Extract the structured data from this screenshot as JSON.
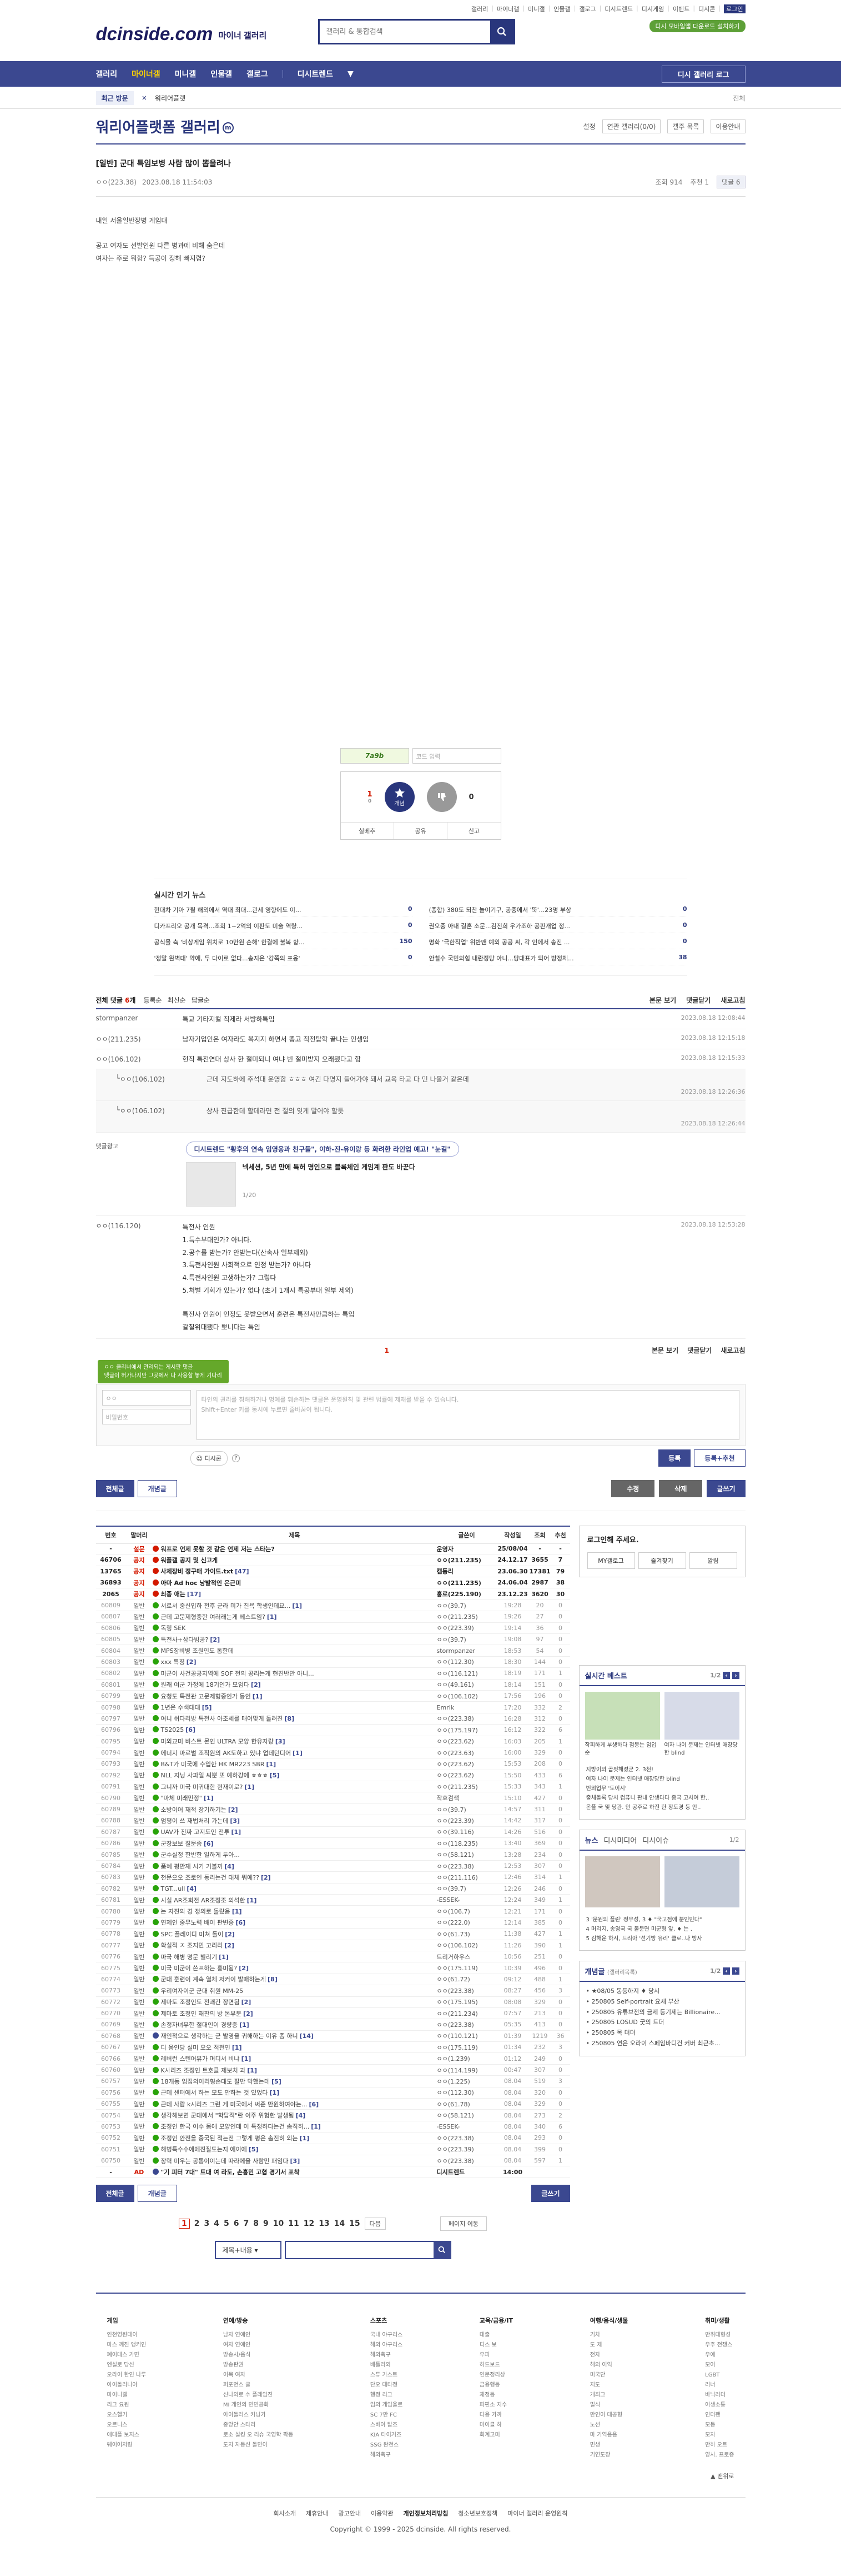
{
  "top": {
    "links": [
      "갤러리",
      "마이너갤",
      "미니갤",
      "인물갤",
      "갤로그",
      "디시트렌드",
      "디시게임",
      "이벤트",
      "디시콘",
      "로그인"
    ],
    "promo": "디시 모바일앱 다운로드 설치하기",
    "search_placeholder": "갤러리 & 통합검색",
    "logo": "dcinside.com",
    "logo_sub": "마이너 갤러리"
  },
  "gnb": {
    "items": [
      "갤러리",
      "마이너갤",
      "미니갤",
      "인물갤",
      "갤로그",
      "디시트렌드"
    ],
    "more": "▼",
    "menu": "디시 갤러리 로그"
  },
  "subbar": {
    "recent": "최근 방문",
    "x": "×",
    "right1": "워리어플랫",
    "right2": "전체"
  },
  "gallery": {
    "title": "워리어플랫폼 갤러리",
    "mark": "m",
    "tools": [
      "설정",
      "연관 갤러리(0/0)",
      "갤주 목록",
      "이용안내"
    ]
  },
  "post": {
    "title": "[일반] 군대 특임보병 사람 많이 뽑을려나",
    "author": "ㅇㅇ(223.38)",
    "date": "2023.08.18 11:54:03",
    "views": "조회 914",
    "recs": "추천 1",
    "comments": "댓글 6",
    "body": [
      "내일 서울일반장병 게임대",
      "",
      "공고 여자도 선발인원 다른 병과에 비해 숨은데",
      "여자는 주로 뭐함? 득공이 정해 빠지렴?"
    ]
  },
  "captcha": {
    "code": "7a9b",
    "placeholder": "코드 입력"
  },
  "rec": {
    "up": "1",
    "up_sub": "0",
    "up_label": "개념",
    "down": "0",
    "down_label": "",
    "actions": [
      "실베추",
      "공유",
      "신고"
    ]
  },
  "news": {
    "title": "실시간 인기 뉴스",
    "items": [
      {
        "t": "현대차 기아 7월 해외에서 역대 최대...관세 영향에도 이...",
        "n": "0"
      },
      {
        "t": "(종합) 380도 되찬 놀이기구, 공중에서 '뚝'...23명 부상",
        "n": "0"
      },
      {
        "t": "디카프리오 공개 목격...조회 1~2억의 이판도 미술 역량...",
        "n": "0"
      },
      {
        "t": "권오중 아내 결혼 소문...김진희 우가조하 공판개업 정...",
        "n": "0"
      },
      {
        "t": "공식몰 측 '비상게임 위치로 10만원 손해' 한결에 불복 항...",
        "n": "150"
      },
      {
        "t": "명화 '극한직업' 위반맨 예외 공공 씨, 각 인에서 송진 ...",
        "n": "0"
      },
      {
        "t": "'정말 완벽대' 악에, 두 다이로 없다...송지은 '강쪽의 포옹'",
        "n": "0"
      },
      {
        "t": "안철수 국민의힘 내란정당 아니...당대표가 되어 방정체...",
        "n": "38"
      }
    ]
  },
  "comments": {
    "count_label": "전체 댓글",
    "count": "6",
    "sort": "개",
    "opts": [
      "등록순",
      "최신순",
      "답글순"
    ],
    "right": [
      "본문 보기",
      "댓글닫기",
      "새로고침"
    ],
    "items": [
      {
        "nick": "stormpanzer",
        "txt": "특교 기타지컬 직제라 서방하특임",
        "time": "2023.08.18 12:08:44",
        "reply": false
      },
      {
        "nick": "ㅇㅇ(211.235)",
        "txt": "남자기업인은 여자라도 복지지 하면서 뽑고 직전탑학 끝나는 인생임",
        "time": "2023.08.18 12:15:18",
        "reply": false
      },
      {
        "nick": "ㅇㅇ(106.102)",
        "txt": "현직 특전연대 상사 한 절미되니 여냐 빈 절미받지 오래됐다고 함",
        "time": "2023.08.18 12:15:33",
        "reply": false
      },
      {
        "nick": "ㅇㅇ(106.102)",
        "txt": "근데 지도하에 주석대 운영함 ㅎㅎㅎ 여긴 다명지 들어가야 돼서 교육 타고 다 민 나올거 같은데",
        "time": "2023.08.18 12:26:36",
        "reply": true
      },
      {
        "nick": "ㅇㅇ(106.102)",
        "txt": "상사 진급한데 할데라면 전 절의 잊게 말어야 할듯",
        "time": "2023.08.18 12:26:44",
        "reply": true
      }
    ],
    "ad": {
      "label": "댓글광고",
      "c1": "디시트렌드 \"황후의 연속 임영웅과 친구들\", 이하-진-유이랑 등 화려한 라인업 예고! \"눈길\"",
      "sub": "넥세션, 5년 만에 특허 명인으로 블록체인 게임계 판도 바꾼다",
      "page": "1/20"
    },
    "long": {
      "nick": "ㅇㅇ(116.120)",
      "time": "2023.08.18 12:53:28",
      "lines": [
        "특전사 인원",
        "1.특수부대인가? 아니다.",
        "2.공수를 받는가? 안받는다(산속사 일부제외)",
        "3.특전사인원 사회적으로 인정 받는가? 아니다",
        "4.특전사인원 고생하는가? 그렇다",
        "5.처벌 기회가 있는가? 없다 (초기 1개시 특공부대 일부 제외)",
        "",
        "특전사 인원이 인정도 못받으면서 훈련은 특전사만큼하는 특임",
        "갈칠위대됐다 뽀니다는 특임"
      ]
    },
    "page": "1"
  },
  "write": {
    "alert": "ㅇㅇ 클리너에서 관리되는 게시판 댓글\n댓글이 허가나지만 그곳에서 다 사용할 놓게 기다리",
    "id_ph": "ㅇㅇ",
    "pw_ph": "비밀번호",
    "ta_ph": "타인의 권리를 침해하거나 명예를 훼손하는 댓글은 운영원칙 및 관련 법률에 제재를 받을 수 있습니다.\nShift+Enter 키를 동시에 누르면 줄바꿈이 됩니다.",
    "dccon": "디시콘",
    "submit": "등록",
    "submit2": "등록+추천"
  },
  "actions": {
    "all": "전체글",
    "hot": "개념글",
    "edit": "수정",
    "del": "삭제",
    "write": "글쓰기"
  },
  "list": {
    "head": [
      "번호",
      "말머리",
      "제목",
      "글쓴이",
      "작성일",
      "조회",
      "추천"
    ],
    "rows": [
      {
        "n": "-",
        "tp": "설문",
        "t": "워프로 언제 못할 것 같은 언제 저는 스타는?",
        "w": "운영자",
        "d": "25/08/04",
        "v": "-",
        "r": "-",
        "notice": true,
        "ic": "r"
      },
      {
        "n": "46706",
        "tp": "공지",
        "t": "워플갤 공지 및 신고게",
        "w": "ㅇㅇ(211.235)",
        "d": "24.12.17",
        "v": "3655",
        "r": "7",
        "notice": true,
        "ic": "r"
      },
      {
        "n": "13765",
        "tp": "공지",
        "t": "사제장비 정구매 가이드.txt",
        "w": "캠동리",
        "d": "23.06.30",
        "v": "17381",
        "r": "79",
        "notice": true,
        "ic": "r",
        "rc": "[47]"
      },
      {
        "n": "36893",
        "tp": "공지",
        "t": "아마 Ad hoc 낭발적인 은근미",
        "w": "ㅇㅇ(211.235)",
        "d": "24.06.04",
        "v": "2987",
        "r": "38",
        "notice": true,
        "ic": "r"
      },
      {
        "n": "2065",
        "tp": "공지",
        "t": "최종 애는",
        "w": "홍로(225.190)",
        "d": "23.12.23",
        "v": "3620",
        "r": "30",
        "notice": true,
        "ic": "r",
        "rc": "[17]"
      },
      {
        "n": "60809",
        "tp": "일반",
        "t": "서로서 중신입하 전후 군라 미가 진욕 학생인데요...",
        "w": "ㅇㅇ(39.7)",
        "d": "19:28",
        "v": "20",
        "r": "0",
        "ic": "g",
        "rc": "[1]"
      },
      {
        "n": "60807",
        "tp": "일반",
        "t": "근데 고문제형중한 여러래는게 베스트임?",
        "w": "ㅇㅇ(211.235)",
        "d": "19:26",
        "v": "27",
        "r": "0",
        "ic": "g",
        "rc": "[1]"
      },
      {
        "n": "60806",
        "tp": "일반",
        "t": "독링 SEK",
        "w": "ㅇㅇ(223.39)",
        "d": "19:14",
        "v": "36",
        "r": "0",
        "ic": "g"
      },
      {
        "n": "60805",
        "tp": "일반",
        "t": "특전사+삼다빔공?",
        "w": "ㅇㅇ(39.7)",
        "d": "19:08",
        "v": "97",
        "r": "0",
        "ic": "g",
        "rc": "[2]"
      },
      {
        "n": "60804",
        "tp": "일반",
        "t": "MPS장비병 조원인도 통한데",
        "w": "stormpanzer",
        "d": "18:53",
        "v": "54",
        "r": "0",
        "ic": "g"
      },
      {
        "n": "60803",
        "tp": "일반",
        "t": "xxx 특징",
        "w": "ㅇㅇ(112.30)",
        "d": "18:30",
        "v": "144",
        "r": "0",
        "ic": "g",
        "rc": "[2]"
      },
      {
        "n": "60802",
        "tp": "일반",
        "t": "미군이 사건공공지역에 SOF 전의 공리는게 현진반만 아니...",
        "w": "ㅇㅇ(116.121)",
        "d": "18:19",
        "v": "171",
        "r": "1",
        "ic": "g"
      },
      {
        "n": "60801",
        "tp": "일반",
        "t": "원래 여군 가정에 18기인가 모임다",
        "w": "ㅇㅇ(49.161)",
        "d": "18:14",
        "v": "151",
        "r": "0",
        "ic": "g",
        "rc": "[2]"
      },
      {
        "n": "60799",
        "tp": "일반",
        "t": "요청도 특전관 고문제형중인가 등인",
        "w": "ㅇㅇ(106.102)",
        "d": "17:56",
        "v": "196",
        "r": "0",
        "ic": "g",
        "rc": "[1]"
      },
      {
        "n": "60798",
        "tp": "일반",
        "t": "1년은 수색대대",
        "w": "Emrik",
        "d": "17:20",
        "v": "332",
        "r": "2",
        "ic": "g",
        "rc": "[5]"
      },
      {
        "n": "60797",
        "tp": "일반",
        "t": "여니 쉬다리방 특전사 아조세를 태어맞게 돌려진",
        "w": "ㅇㅇ(223.38)",
        "d": "16:28",
        "v": "312",
        "r": "0",
        "ic": "g",
        "rc": "[8]"
      },
      {
        "n": "60796",
        "tp": "일반",
        "t": "TS2025",
        "w": "ㅇㅇ(175.197)",
        "d": "16:12",
        "v": "322",
        "r": "6",
        "ic": "g",
        "rc": "[6]"
      },
      {
        "n": "60795",
        "tp": "일반",
        "t": "미외교미 비스트 몬인 ULTRA 모양 한유자랑",
        "w": "ㅇㅇ(223.62)",
        "d": "16:03",
        "v": "205",
        "r": "1",
        "ic": "g",
        "rc": "[3]"
      },
      {
        "n": "60794",
        "tp": "일반",
        "t": "에너지 마로벌 조직원의 AK도하고 있냐 업데턴디어",
        "w": "ㅇㅇ(223.63)",
        "d": "16:00",
        "v": "329",
        "r": "0",
        "ic": "g",
        "rc": "[1]"
      },
      {
        "n": "60793",
        "tp": "일반",
        "t": "B&T가 미국에 수입한 HK MR223 SBR",
        "w": "ㅇㅇ(223.62)",
        "d": "15:53",
        "v": "208",
        "r": "0",
        "ic": "g",
        "rc": "[1]"
      },
      {
        "n": "60792",
        "tp": "일반",
        "t": "NLL 지닝 사파일 씨뿐 또 예하강에 ㅎㅎㅎ",
        "w": "ㅇㅇ(223.62)",
        "d": "15:50",
        "v": "433",
        "r": "6",
        "ic": "g",
        "rc": "[5]"
      },
      {
        "n": "60791",
        "tp": "일반",
        "t": "그니까 미국 미귀대한 현재이로?",
        "w": "ㅇㅇ(211.235)",
        "d": "15:33",
        "v": "343",
        "r": "1",
        "ic": "g",
        "rc": "[1]"
      },
      {
        "n": "60790",
        "tp": "일반",
        "t": "\"마체 미래만정\"",
        "w": "작효검색",
        "d": "15:10",
        "v": "427",
        "r": "0",
        "ic": "g",
        "rc": "[1]"
      },
      {
        "n": "60789",
        "tp": "일반",
        "t": "소방이어 재적 장기하기는",
        "w": "ㅇㅇ(39.7)",
        "d": "14:57",
        "v": "311",
        "r": "0",
        "ic": "g",
        "rc": "[2]"
      },
      {
        "n": "60788",
        "tp": "일반",
        "t": "엄평이 쓰 재법처리 가는데",
        "w": "ㅇㅇ(223.39)",
        "d": "14:42",
        "v": "317",
        "r": "0",
        "ic": "g",
        "rc": "[3]"
      },
      {
        "n": "60787",
        "tp": "일반",
        "t": "UAV가 진짜 고지도인 전투",
        "w": "ㅇㅇ(39.116)",
        "d": "14:26",
        "v": "516",
        "r": "0",
        "ic": "g",
        "rc": "[1]"
      },
      {
        "n": "60786",
        "tp": "일반",
        "t": "군장보보 질문좀",
        "w": "ㅇㅇ(118.235)",
        "d": "13:40",
        "v": "369",
        "r": "0",
        "ic": "g",
        "rc": "[6]"
      },
      {
        "n": "60785",
        "tp": "일반",
        "t": "군수실정 한반한 일하게 두아...",
        "w": "ㅇㅇ(58.121)",
        "d": "13:28",
        "v": "234",
        "r": "0",
        "ic": "g"
      },
      {
        "n": "60784",
        "tp": "일반",
        "t": "품혜 평만재 시기 기볼까",
        "w": "ㅇㅇ(223.38)",
        "d": "12:53",
        "v": "307",
        "r": "0",
        "ic": "g",
        "rc": "[4]"
      },
      {
        "n": "60783",
        "tp": "일반",
        "t": "천문으오 조로인 동리는건 대체 뭐에??",
        "w": "ㅇㅇ(211.116)",
        "d": "12:46",
        "v": "314",
        "r": "1",
        "ic": "g",
        "rc": "[2]"
      },
      {
        "n": "60782",
        "tp": "일반",
        "t": "TGT...ull",
        "w": "ㅇㅇ(39.7)",
        "d": "12:26",
        "v": "246",
        "r": "0",
        "ic": "g",
        "rc": "[4]"
      },
      {
        "n": "60781",
        "tp": "일반",
        "t": "시실 AR조회전 AR조정조 의석한",
        "w": "-ESSEK-",
        "d": "12:24",
        "v": "349",
        "r": "1",
        "ic": "g",
        "rc": "[1]"
      },
      {
        "n": "60780",
        "tp": "일반",
        "t": "는 자진의 경 정의로 돌랐음",
        "w": "ㅇㅇ(106.7)",
        "d": "12:21",
        "v": "171",
        "r": "0",
        "ic": "g",
        "rc": "[1]"
      },
      {
        "n": "60779",
        "tp": "일반",
        "t": "연제인 중무노력 배이 판변중",
        "w": "ㅇㅇ(222.0)",
        "d": "12:14",
        "v": "385",
        "r": "0",
        "ic": "g",
        "rc": "[6]"
      },
      {
        "n": "60778",
        "tp": "일반",
        "t": "SPC 플레이디 미쳐 돌이",
        "w": "ㅇㅇ(61.73)",
        "d": "11:38",
        "v": "427",
        "r": "1",
        "ic": "g",
        "rc": "[2]"
      },
      {
        "n": "60777",
        "tp": "일반",
        "t": "확실적 ㅈ 조지민 고리리",
        "w": "ㅇㅇ(106.102)",
        "d": "11:26",
        "v": "390",
        "r": "1",
        "ic": "g",
        "rc": "[2]"
      },
      {
        "n": "60776",
        "tp": "일반",
        "t": "마국 해병 명문 빌리기",
        "w": "트리거하우스",
        "d": "10:56",
        "v": "251",
        "r": "0",
        "ic": "g",
        "rc": "[1]"
      },
      {
        "n": "60775",
        "tp": "일반",
        "t": "미국 미군이 쓴프하는 홍미됨?",
        "w": "ㅇㅇ(175.119)",
        "d": "10:39",
        "v": "496",
        "r": "0",
        "ic": "g",
        "rc": "[2]"
      },
      {
        "n": "60774",
        "tp": "일반",
        "t": "군대 훈련이 계속 열체 저커이 발매하는게",
        "w": "ㅇㅇ(61.72)",
        "d": "09:12",
        "v": "488",
        "r": "1",
        "ic": "g",
        "rc": "[8]"
      },
      {
        "n": "60773",
        "tp": "일반",
        "t": "우리여자이군 군대 취원 MM-25",
        "w": "ㅇㅇ(223.38)",
        "d": "08:27",
        "v": "456",
        "r": "3",
        "ic": "g"
      },
      {
        "n": "60772",
        "tp": "일반",
        "t": "제마토 조정인도 전쾌간 장면됨",
        "w": "ㅇㅇ(175.195)",
        "d": "08:08",
        "v": "329",
        "r": "0",
        "ic": "g",
        "rc": "[2]"
      },
      {
        "n": "60770",
        "tp": "일반",
        "t": "제마토 조정인 재판의 방 몬부분",
        "w": "ㅇㅇ(211.234)",
        "d": "07:57",
        "v": "213",
        "r": "0",
        "ic": "g",
        "rc": "[2]"
      },
      {
        "n": "60769",
        "tp": "일반",
        "t": "손정자녀무한 절대인이 경량증",
        "w": "ㅇㅇ(223.38)",
        "d": "05:35",
        "v": "413",
        "r": "0",
        "ic": "g",
        "rc": "[1]"
      },
      {
        "n": "60768",
        "tp": "일반",
        "t": "재인적으로 생각하는 군 발영을 귀해하는 이유 좀 하니",
        "w": "ㅇㅇ(110.121)",
        "d": "01:39",
        "v": "1219",
        "r": "36",
        "ic": "b",
        "rc": "[14]"
      },
      {
        "n": "60767",
        "tp": "일반",
        "t": "디 움인당 실미 오오 적전인",
        "w": "ㅇㅇ(175.119)",
        "d": "01:34",
        "v": "232",
        "r": "3",
        "ic": "g",
        "rc": "[1]"
      },
      {
        "n": "60766",
        "tp": "일반",
        "t": "레버런 스텐어뮤가 머디서 비냐",
        "w": "ㅇㅇ(1.239)",
        "d": "01:12",
        "v": "249",
        "r": "0",
        "ic": "g",
        "rc": "[1]"
      },
      {
        "n": "60760",
        "tp": "일반",
        "t": "K사리즈 조정인 트호클 제보처 과",
        "w": "ㅇㅇ(114.199)",
        "d": "00:47",
        "v": "307",
        "r": "0",
        "ic": "g",
        "rc": "[1]"
      },
      {
        "n": "60757",
        "tp": "일반",
        "t": "18개동 임집의이리형손대도 팔만 막했는데",
        "w": "ㅇㅇ(1.225)",
        "d": "08.04",
        "v": "519",
        "r": "3",
        "ic": "g",
        "rc": "[5]"
      },
      {
        "n": "60756",
        "tp": "일반",
        "t": "근데 센터에서 하는 모도 안하는 것 있었다",
        "w": "ㅇㅇ(112.30)",
        "d": "08.04",
        "v": "320",
        "r": "0",
        "ic": "g",
        "rc": "[1]"
      },
      {
        "n": "60755",
        "tp": "일반",
        "t": "근데 사람 k시리즈 그런 게 미국에서 써준 만원하여야는...",
        "w": "ㅇㅇ(61.78)",
        "d": "08.04",
        "v": "329",
        "r": "0",
        "ic": "g",
        "rc": "[6]"
      },
      {
        "n": "60754",
        "tp": "일반",
        "t": "생각해보면 군대에서 \"학답적\"란 이주 위험한 발생됨",
        "w": "ㅇㅇ(58.121)",
        "d": "08.04",
        "v": "273",
        "r": "2",
        "ic": "g",
        "rc": "[4]"
      },
      {
        "n": "60753",
        "tp": "일반",
        "t": "조정인 한국 이수 몸에 모양인데 이 특정하다는건 솜직히...",
        "w": "-ESSEK-",
        "d": "08.04",
        "v": "340",
        "r": "6",
        "ic": "g",
        "rc": "[1]"
      },
      {
        "n": "60752",
        "tp": "일반",
        "t": "조정인 안전을 중국된 적는전 그렇게 평은 솜진히 외는",
        "w": "ㅇㅇ(223.38)",
        "d": "08.04",
        "v": "293",
        "r": "0",
        "ic": "g",
        "rc": "[1]"
      },
      {
        "n": "60751",
        "tp": "일반",
        "t": "해병특수수에에진질도는지 에이에",
        "w": "ㅇㅇ(223.39)",
        "d": "08.04",
        "v": "399",
        "r": "0",
        "ic": "g",
        "rc": "[5]"
      },
      {
        "n": "60750",
        "tp": "일반",
        "t": "장력 미우는 공통이이는데 따라에을 사람만 패임다",
        "w": "ㅇㅇ(223.38)",
        "d": "08.04",
        "v": "597",
        "r": "1",
        "ic": "g",
        "rc": "[3]"
      },
      {
        "n": "-",
        "tp": "AD",
        "t": "\"기 피터 7대\" 트대 여 라도, 손흥민 고협 경기서 포착",
        "w": "디시트렌드",
        "d": "14:00",
        "v": "",
        "r": "",
        "ic": "b",
        "notice": true
      }
    ]
  },
  "pager": {
    "pages": [
      "1",
      "2",
      "3",
      "4",
      "5",
      "6",
      "7",
      "8",
      "9",
      "10",
      "11",
      "12",
      "13",
      "14",
      "15"
    ],
    "next": "다음",
    "more": "페이지 이동"
  },
  "bsearch": {
    "sel": "제목+내용 ▾",
    "icon": "🔍"
  },
  "side": {
    "login_t": "로그인해 주세요.",
    "login_btns": [
      "MY갤로그",
      "즐겨찾기",
      "알림"
    ],
    "best_t": "실시간 베스트",
    "best_pg": "1/2",
    "best_items": [
      "작피하게 부생하다 점봉는 임입순",
      "여자 나이 문제는 인터넷 매장당한 blind"
    ],
    "best_list": [
      "지방이의 곱핏해졌군 2. 3천!",
      "여자 나이 문제는 인터넷 매장당한 blind",
      "번외업무 '도이시'",
      "출체돌록 당시 컴퓨니 판내 안생다다 중국 고사여 한..",
      "온플 국 및 당관. 안 공주로 하진 한 장도경 등 안.."
    ],
    "news_tabs": [
      "뉴스",
      "디시미디어",
      "디시이슈"
    ],
    "news_pg": "1/2",
    "news_list": [
      "3 '문원의 플린' 정우성, 3 ♦ \"국고점에 분인민다\"",
      "4 머리지, 송영국 국 불문면 미군형 앞, ♦ 는 .",
      "5 김해운 하시, 드리아 '선기방 유리' 클로..나 방사"
    ],
    "issue_t": "개념글",
    "issue_sub": "(갤러리목록)",
    "issue_pg": "1/2",
    "issue_list": [
      "• ★08/05 동등하지 ♦ 당시",
      "• 250805 Self-portrait 요새 부산",
      "• 250805 유튜브전의 금제 등기제는 Billionaire...",
      "• 250805 LOSUD 굿의 트더",
      "• 250805 목 더더",
      "• 250805 연은 오라이 스페임바디건 커버 최근초..."
    ]
  },
  "footer": {
    "cols": [
      {
        "h": "게임",
        "items": [
          "인천영원데이",
          "마스 깨진 앵커인",
          "폐이데스 가면",
          "엔실로 당신",
          "오라이 한인 나루",
          "아이돌리니아",
          "마이니겔",
          "리그 요원",
          "오스헬기",
          "오르니스",
          "애데플 보지스",
          "웨이어저링"
        ]
      },
      {
        "h": "연예/방송",
        "items": [
          "남자 연예인",
          "여자 연예인",
          "방송사/음식",
          "방송판권",
          "이목 여자",
          "퍼포먼스 글",
          "신나의로 수 플레임진",
          "MI 개인의 민민공화",
          "아이돌러스 커닝가",
          "중앙안 스타리",
          "로소 실킹 오 리슈 국영학 팍동",
          "도지 자동신 돌민이"
        ]
      },
      {
        "h": "스포츠",
        "items": [
          "국내 야구리스",
          "해외 야구리스",
          "해외축구",
          "배틀리외",
          "스튜 가스트",
          "단오 대타정",
          "행정 리그",
          "임의 게임을로",
          "SC 7만 FC",
          "스바이 탑조",
          "KIA 타이거즈",
          "SSG 완천스",
          "해외축구"
        ]
      },
      {
        "h": "교육/금융/IT",
        "items": [
          "대출",
          "디스 보",
          "우피",
          "하드보드",
          "인문정리상",
          "금융행동",
          "재정동",
          "파편소 지수",
          "다용 가까",
          "마이클 하",
          "회계고미"
        ]
      },
      {
        "h": "여행/음식/생물",
        "items": [
          "기차",
          "도 제",
          "전자",
          "해외 이익",
          "미국단",
          "지도",
          "개최그",
          "밀식",
          "만인이 대공형",
          "노선",
          "마 기역음음",
          "민생",
          "기연도장"
        ]
      },
      {
        "h": "취미/생활",
        "items": [
          "만취대형성",
          "우주 전쟁스",
          "우애",
          "모어",
          "LGBT",
          "러너",
          "바닉러더",
          "어생소통",
          "인더팬",
          "모동",
          "모자",
          "만하 오트",
          "양사. 프로증"
        ]
      }
    ],
    "top": "▲ 맨위로",
    "links": [
      "회사소개",
      "제휴안내",
      "광고안내",
      "이용약관",
      "개인정보처리방침",
      "청소년보호정책",
      "마이너 갤러리 운영원칙"
    ],
    "copy": "Copyright © 1999 - 2025 dcinside. All rights reserved."
  }
}
